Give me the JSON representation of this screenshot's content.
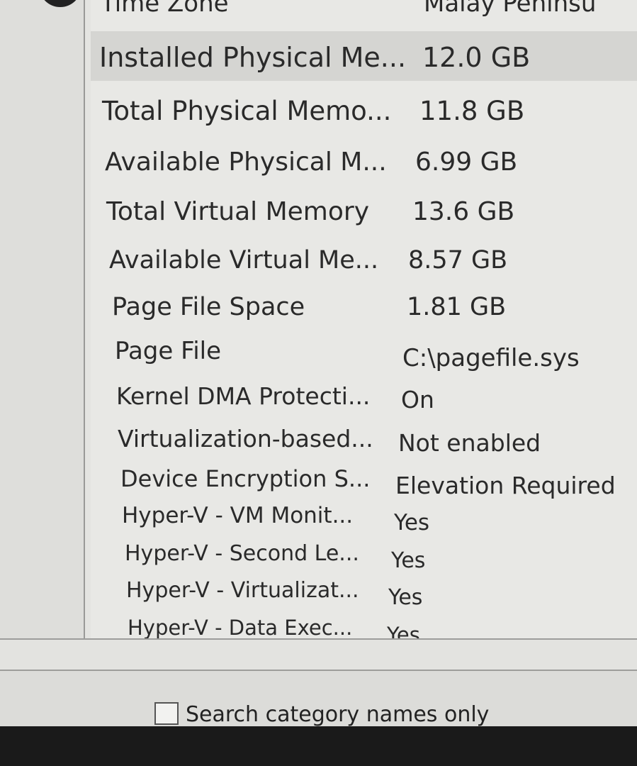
{
  "window": {
    "rows": [
      {
        "name": "Time Zone",
        "value": "Malay Peninsu"
      },
      {
        "name": "Installed Physical Me...",
        "value": "12.0 GB"
      },
      {
        "name": "Total Physical Memo...",
        "value": "11.8 GB"
      },
      {
        "name": "Available Physical M...",
        "value": "6.99 GB"
      },
      {
        "name": "Total Virtual Memory",
        "value": "13.6 GB"
      },
      {
        "name": "Available Virtual Me...",
        "value": "8.57 GB"
      },
      {
        "name": "Page File Space",
        "value": "1.81 GB"
      },
      {
        "name": "Page File",
        "value": "C:\\pagefile.sys"
      },
      {
        "name": "Kernel DMA Protecti...",
        "value": "On"
      },
      {
        "name": "Virtualization-based...",
        "value": "Not enabled"
      },
      {
        "name": "Device Encryption S...",
        "value": "Elevation Required"
      },
      {
        "name": "Hyper-V - VM Monit...",
        "value": "Yes"
      },
      {
        "name": "Hyper-V - Second Le...",
        "value": "Yes"
      },
      {
        "name": "Hyper-V - Virtualizat...",
        "value": "Yes"
      },
      {
        "name": "Hyper-V - Data Exec...",
        "value": "Yes"
      }
    ]
  },
  "search": {
    "checkbox_label": "Search category names only",
    "checked": false
  },
  "colors": {
    "selected_row": "#d5d5d2",
    "text": "#2a2a2a"
  }
}
